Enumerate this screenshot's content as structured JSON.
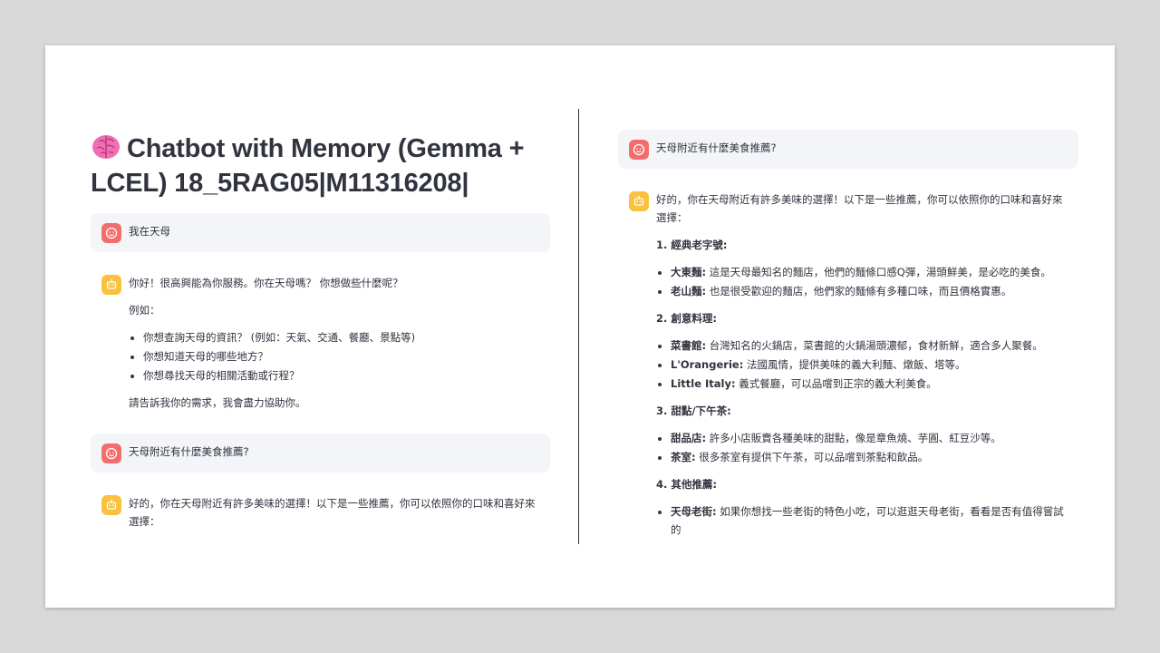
{
  "left": {
    "title": "Chatbot with Memory (Gemma + LCEL) 18_5RAG05|M11316208|",
    "msg1": {
      "text": "我在天母"
    },
    "msg2": {
      "intro": "你好！很高興能為你服務。你在天母嗎？ 你想做些什麼呢？",
      "example_label": "例如：",
      "items": [
        "你想查詢天母的資訊？ (例如：天氣、交通、餐廳、景點等)",
        "你想知道天母的哪些地方？",
        "你想尋找天母的相關活動或行程？"
      ],
      "outro": "請告訴我你的需求，我會盡力協助你。"
    },
    "msg3": {
      "text": "天母附近有什麼美食推薦?"
    },
    "msg4": {
      "text": "好的，你在天母附近有許多美味的選擇！以下是一些推薦，你可以依照你的口味和喜好來選擇："
    }
  },
  "right": {
    "user_msg": "天母附近有什麼美食推薦?",
    "bot_intro": "好的，你在天母附近有許多美味的選擇！以下是一些推薦，你可以依照你的口味和喜好來選擇：",
    "sections": [
      {
        "heading": "1. 經典老字號:",
        "items": [
          {
            "name": "大東麵:",
            "desc": " 這是天母最知名的麵店，他們的麵條口感Q彈，湯頭鮮美，是必吃的美食。"
          },
          {
            "name": "老山麵:",
            "desc": " 也是很受歡迎的麵店，他們家的麵條有多種口味，而且價格實惠。"
          }
        ]
      },
      {
        "heading": "2. 創意料理:",
        "items": [
          {
            "name": "菜書館:",
            "desc": " 台灣知名的火鍋店，菜書館的火鍋湯頭濃郁，食材新鮮，適合多人聚餐。"
          },
          {
            "name": "L'Orangerie:",
            "desc": " 法國風情，提供美味的義大利麵、燉飯、塔等。"
          },
          {
            "name": "Little Italy:",
            "desc": " 義式餐廳，可以品嚐到正宗的義大利美食。"
          }
        ]
      },
      {
        "heading": "3. 甜點/下午茶:",
        "items": [
          {
            "name": "甜品店:",
            "desc": " 許多小店販賣各種美味的甜點，像是章魚燒、芋圓、紅豆沙等。"
          },
          {
            "name": "茶室:",
            "desc": " 很多茶室有提供下午茶，可以品嚐到茶點和飲品。"
          }
        ]
      },
      {
        "heading": "4. 其他推薦:",
        "items": [
          {
            "name": "天母老街:",
            "desc": " 如果你想找一些老街的特色小吃，可以逛逛天母老街，看看是否有值得嘗試的"
          }
        ]
      }
    ]
  },
  "colors": {
    "user_avatar": "#f46c6c",
    "bot_avatar": "#f9c13d",
    "user_bubble": "#f4f5f8",
    "text": "#31333f",
    "brain_icon": "#f06fb4"
  },
  "icons": {
    "title": "brain-icon",
    "user_avatar": "smiley-face-icon",
    "bot_avatar": "robot-face-icon"
  }
}
